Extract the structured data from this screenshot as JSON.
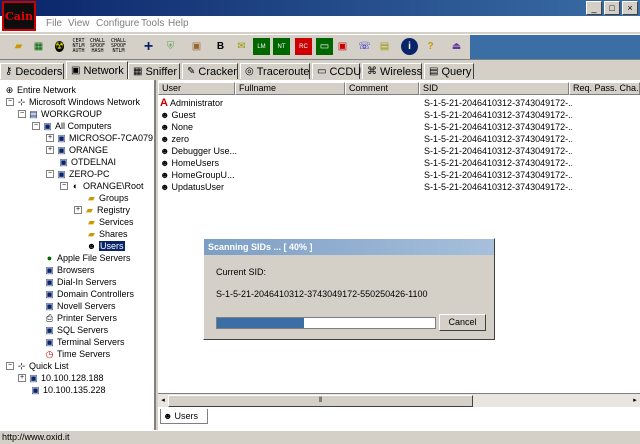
{
  "window": {
    "app_icon_text": "Cain",
    "minimize_glyph": "_",
    "maximize_glyph": "□",
    "close_glyph": "×"
  },
  "menubar": {
    "items": [
      "File",
      "View",
      "Configure",
      "Tools",
      "Help"
    ]
  },
  "toolbar": {
    "icons": [
      "open-icon",
      "network-icon",
      "radiation-icon",
      "hash-calc-icon",
      "spoof-icon",
      "tele-icon",
      "plus-icon",
      "shield-icon",
      "b64-icon",
      "b64-decode-icon",
      "cert-icon",
      "ini-icon",
      "wep-icon",
      "ssid-icon",
      "video-icon",
      "voip-icon",
      "tcp-icon",
      "info-icon",
      "help-icon",
      "exit-icon"
    ],
    "text_icons": [
      {
        "l1": "CERT",
        "l2": "NTLM",
        "l3": "AUTH"
      },
      {
        "l1": "CHALL",
        "l2": "SPOOF",
        "l3": "HASH"
      },
      {
        "l1": "CHALL",
        "l2": "SPOOF",
        "l3": "NTLM"
      }
    ]
  },
  "tabs": [
    {
      "label": "Decoders",
      "icon": "key-icon"
    },
    {
      "label": "Network",
      "icon": "network-icon"
    },
    {
      "label": "Sniffer",
      "icon": "sniffer-icon"
    },
    {
      "label": "Cracker",
      "icon": "cracker-icon"
    },
    {
      "label": "Traceroute",
      "icon": "traceroute-icon"
    },
    {
      "label": "CCDU",
      "icon": "ccdu-icon"
    },
    {
      "label": "Wireless",
      "icon": "wireless-icon"
    },
    {
      "label": "Query",
      "icon": "query-icon"
    }
  ],
  "active_tab": "Network",
  "tree": {
    "entire_network": "Entire Network",
    "ms_network": "Microsoft Windows Network",
    "workgroup": "WORKGROUP",
    "all_computers": "All Computers",
    "computers": [
      "MICROSOF-7CA079",
      "ORANGE",
      "OTDELNAI",
      "ZERO-PC"
    ],
    "orange_root": "ORANGE\\Root",
    "root_children": [
      "Groups",
      "Registry",
      "Services",
      "Shares",
      "Users"
    ],
    "selected": "Users",
    "server_types": [
      "Apple File Servers",
      "Browsers",
      "Dial-In Servers",
      "Domain Controllers",
      "Novell Servers",
      "Printer Servers",
      "SQL Servers",
      "Terminal Servers",
      "Time Servers"
    ],
    "quick_list": "Quick List",
    "quick_items": [
      "10.100.128.188",
      "10.100.135.228"
    ]
  },
  "grid": {
    "columns": [
      "User",
      "Fullname",
      "Comment",
      "SID",
      "Req. Pass. Cha..."
    ],
    "rows": [
      {
        "user": "Administrator",
        "sid": "S-1-5-21-2046410312-3743049172-..."
      },
      {
        "user": "Guest",
        "sid": "S-1-5-21-2046410312-3743049172-..."
      },
      {
        "user": "None",
        "sid": "S-1-5-21-2046410312-3743049172-..."
      },
      {
        "user": "zero",
        "sid": "S-1-5-21-2046410312-3743049172-..."
      },
      {
        "user": "Debugger Use...",
        "sid": "S-1-5-21-2046410312-3743049172-..."
      },
      {
        "user": "HomeUsers",
        "sid": "S-1-5-21-2046410312-3743049172-..."
      },
      {
        "user": "HomeGroupU...",
        "sid": "S-1-5-21-2046410312-3743049172-..."
      },
      {
        "user": "UpdatusUser",
        "sid": "S-1-5-21-2046410312-3743049172-..."
      }
    ]
  },
  "bottom_tab": "Users",
  "status": "http://www.oxid.it",
  "dialog": {
    "title": "Scanning SIDs ... [ 40% ]",
    "current_label": "Current SID:",
    "current_sid": "S-1-5-21-2046410312-3743049172-550250426-1100",
    "progress_percent": 40,
    "cancel_label": "Cancel"
  }
}
